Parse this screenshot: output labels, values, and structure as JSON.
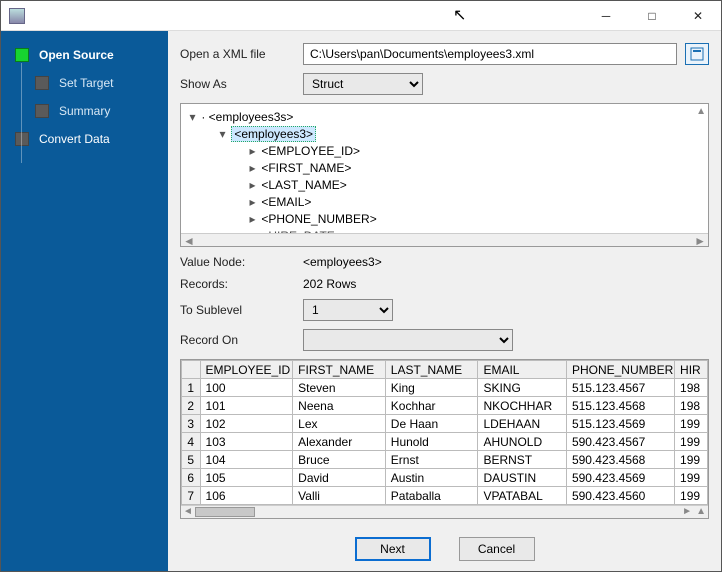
{
  "window": {
    "title": ""
  },
  "sidebar": {
    "items": [
      {
        "label": "Open Source"
      },
      {
        "label": "Set Target"
      },
      {
        "label": "Summary"
      },
      {
        "label": "Convert Data"
      }
    ]
  },
  "form": {
    "open_label": "Open a XML file",
    "path": "C:\\Users\\pan\\Documents\\employees3.xml",
    "show_as_label": "Show As",
    "show_as_value": "Struct",
    "value_node_label": "Value Node:",
    "value_node_value": "<employees3>",
    "records_label": "Records:",
    "records_value": "202 Rows",
    "to_sublevel_label": "To Sublevel",
    "to_sublevel_value": "1",
    "record_on_label": "Record On",
    "record_on_value": ""
  },
  "tree": {
    "root": "<employees3s>",
    "selected": "<employees3>",
    "children": [
      "<EMPLOYEE_ID>",
      "<FIRST_NAME>",
      "<LAST_NAME>",
      "<EMAIL>",
      "<PHONE_NUMBER>",
      "<HIRE_DATE>"
    ]
  },
  "grid": {
    "columns": [
      "EMPLOYEE_ID",
      "FIRST_NAME",
      "LAST_NAME",
      "EMAIL",
      "PHONE_NUMBER",
      "HIR"
    ],
    "rows": [
      [
        "100",
        "Steven",
        "King",
        "SKING",
        "515.123.4567",
        "198"
      ],
      [
        "101",
        "Neena",
        "Kochhar",
        "NKOCHHAR",
        "515.123.4568",
        "198"
      ],
      [
        "102",
        "Lex",
        "De Haan",
        "LDEHAAN",
        "515.123.4569",
        "199"
      ],
      [
        "103",
        "Alexander",
        "Hunold",
        "AHUNOLD",
        "590.423.4567",
        "199"
      ],
      [
        "104",
        "Bruce",
        "Ernst",
        "BERNST",
        "590.423.4568",
        "199"
      ],
      [
        "105",
        "David",
        "Austin",
        "DAUSTIN",
        "590.423.4569",
        "199"
      ],
      [
        "106",
        "Valli",
        "Pataballa",
        "VPATABAL",
        "590.423.4560",
        "199"
      ]
    ]
  },
  "buttons": {
    "next": "Next",
    "cancel": "Cancel"
  }
}
